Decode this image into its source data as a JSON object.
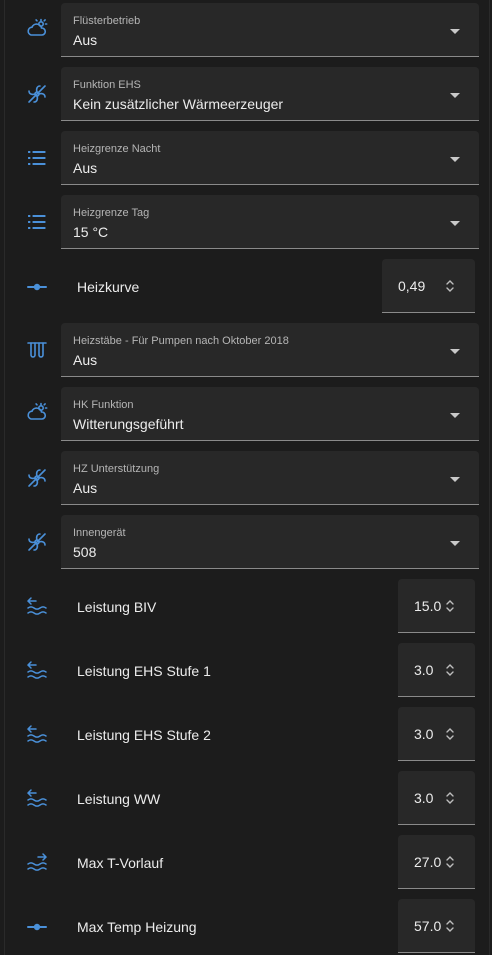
{
  "accent_color": "#4a90d9",
  "selects": [
    {
      "icon": "weather-partly-cloudy-icon",
      "label": "Flüsterbetrieb",
      "value": "Aus"
    },
    {
      "icon": "heat-pump-off-icon",
      "label": "Funktion EHS",
      "value": "Kein zusätzlicher Wärmeerzeuger"
    },
    {
      "icon": "format-list-icon",
      "label": "Heizgrenze Nacht",
      "value": "Aus"
    },
    {
      "icon": "format-list-icon",
      "label": "Heizgrenze Tag",
      "value": "15 °C"
    },
    {
      "icon": "radiator-heating-rod-icon",
      "label": "Heizstäbe - Für Pumpen nach Oktober 2018",
      "value": "Aus"
    },
    {
      "icon": "weather-partly-cloudy-icon",
      "label": "HK Funktion",
      "value": "Witterungsgeführt"
    },
    {
      "icon": "heat-pump-off-icon",
      "label": "HZ Unterstützung",
      "value": "Aus"
    },
    {
      "icon": "heat-pump-off-icon",
      "label": "Innengerät",
      "value": "508"
    }
  ],
  "numbers": [
    {
      "icon": "slider-icon",
      "label": "Heizkurve",
      "value": "0,49"
    },
    {
      "icon": "water-arrow-left-icon",
      "label": "Leistung BIV",
      "value": "15.0"
    },
    {
      "icon": "water-arrow-left-icon",
      "label": "Leistung EHS Stufe 1",
      "value": "3.0"
    },
    {
      "icon": "water-arrow-left-icon",
      "label": "Leistung EHS Stufe 2",
      "value": "3.0"
    },
    {
      "icon": "water-arrow-left-icon",
      "label": "Leistung WW",
      "value": "3.0"
    },
    {
      "icon": "water-arrow-right-icon",
      "label": "Max T-Vorlauf",
      "value": "27.0"
    },
    {
      "icon": "slider-icon",
      "label": "Max Temp Heizung",
      "value": "57.0"
    }
  ]
}
